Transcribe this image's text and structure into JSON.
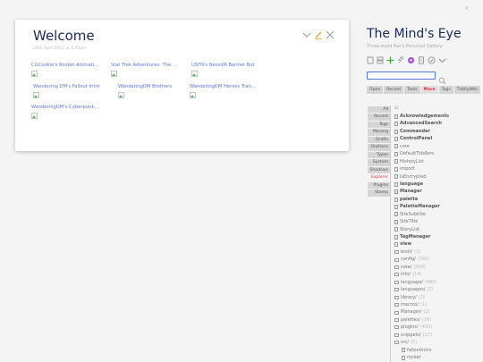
{
  "tiddler": {
    "title": "Welcome",
    "subtitle": "28th April 2022 at 6:41pm",
    "gallery": [
      {
        "label": "CGCookie's Rocket Animati…"
      },
      {
        "label": "Star Trek Adventures: The …"
      },
      {
        "label": "USFN's NeosVR Banner Bot"
      },
      {
        "label": "Wandering DM's Fallout Intro"
      },
      {
        "label": "WanderingDM Brothers"
      },
      {
        "label": "WanderingDM Heroes Tran…"
      },
      {
        "label": "WanderingDM's Cyberpunk…"
      }
    ],
    "colors": {
      "link": "#5778d8",
      "title": "#182955",
      "edit": "#e0a020"
    }
  },
  "sidebar": {
    "site_title": "The Mind's Eye",
    "site_subtitle": "Three-eyed Rat's Personal Gallery",
    "tabs": [
      "Open",
      "Recent",
      "Tools",
      "More",
      "Tags",
      "TiddlyWiki"
    ],
    "more_tabs": [
      "All",
      "Recent",
      "Tags",
      "Missing",
      "Drafts",
      "Orphans",
      "Types",
      "System",
      "Shadows",
      "Explorer",
      "Plugins",
      "Stamp"
    ],
    "crumb": "$/",
    "tree": [
      {
        "type": "file",
        "label": "Acknowledgements",
        "bold": true
      },
      {
        "type": "file",
        "label": "AdvancedSearch",
        "bold": true
      },
      {
        "type": "file",
        "label": "Commander",
        "bold": true
      },
      {
        "type": "file",
        "label": "ControlPanel",
        "bold": true
      },
      {
        "type": "file",
        "label": "core",
        "bold": false
      },
      {
        "type": "file",
        "label": "DefaultTiddlers",
        "bold": false
      },
      {
        "type": "file",
        "label": "HistoryList",
        "bold": false
      },
      {
        "type": "file",
        "label": "import",
        "bold": false
      },
      {
        "type": "file",
        "label": "isEncrypted",
        "bold": false
      },
      {
        "type": "file",
        "label": "language",
        "bold": true
      },
      {
        "type": "file",
        "label": "Manager",
        "bold": true
      },
      {
        "type": "file",
        "label": "palette",
        "bold": true
      },
      {
        "type": "file",
        "label": "PaletteManager",
        "bold": true
      },
      {
        "type": "file",
        "label": "SiteSubtitle",
        "bold": false
      },
      {
        "type": "file",
        "label": "SiteTitle",
        "bold": false
      },
      {
        "type": "file",
        "label": "StoryList",
        "bold": false
      },
      {
        "type": "file",
        "label": "TagManager",
        "bold": true
      },
      {
        "type": "file",
        "label": "view",
        "bold": true
      },
      {
        "type": "folder",
        "label": "boot/",
        "count": "(3)"
      },
      {
        "type": "folder",
        "label": "config/",
        "count": "(241)"
      },
      {
        "type": "folder",
        "label": "core/",
        "count": "(509)"
      },
      {
        "type": "folder",
        "label": "info/",
        "count": "(14)"
      },
      {
        "type": "folder",
        "label": "language/",
        "count": "(486)"
      },
      {
        "type": "folder",
        "label": "languages/",
        "count": "(2)"
      },
      {
        "type": "folder",
        "label": "library/",
        "count": "(2)"
      },
      {
        "type": "folder",
        "label": "macros/",
        "count": "(1)"
      },
      {
        "type": "folder",
        "label": "Manager/",
        "count": "(2)"
      },
      {
        "type": "folder",
        "label": "palettes/",
        "count": "(16)"
      },
      {
        "type": "folder",
        "label": "plugins/",
        "count": "(405)"
      },
      {
        "type": "folder",
        "label": "snippets/",
        "count": "(17)"
      },
      {
        "type": "folder",
        "label": "src/",
        "count": "(6)"
      },
      {
        "type": "file",
        "label": "falloutintro",
        "bold": false,
        "indent": true
      },
      {
        "type": "file",
        "label": "rocket",
        "bold": false,
        "indent": true
      }
    ]
  }
}
